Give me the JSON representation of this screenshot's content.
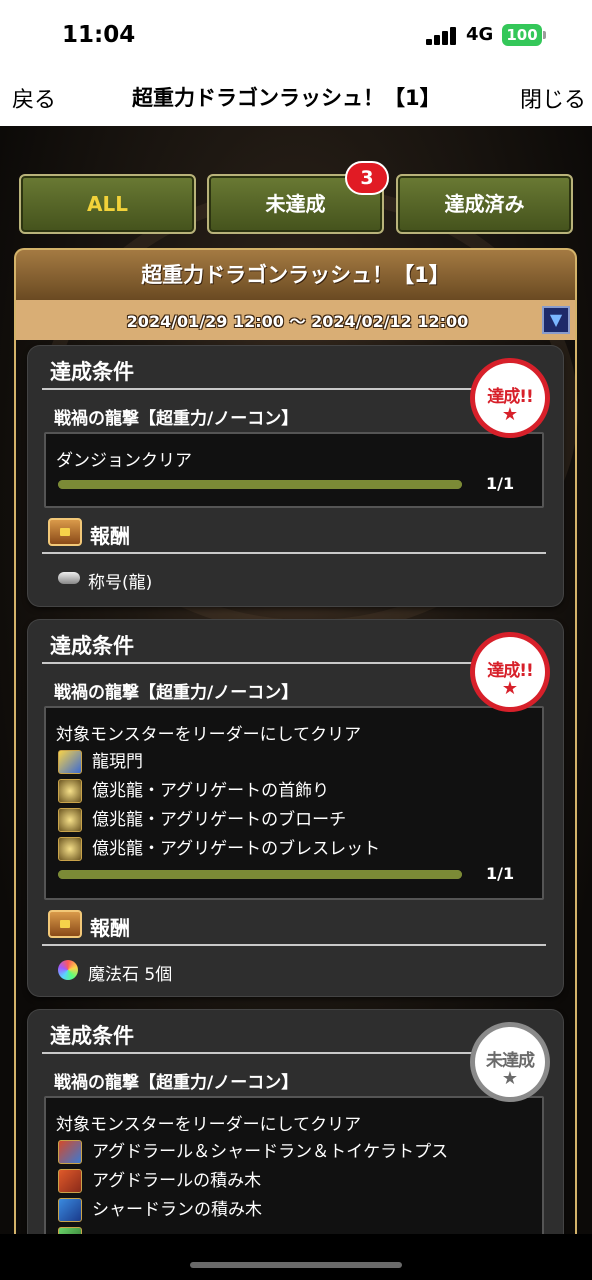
{
  "status_bar": {
    "time": "11:04",
    "network": "4G",
    "battery": "100"
  },
  "nav": {
    "back_label": "戻る",
    "title": "超重力ドラゴンラッシュ！【1】",
    "close_label": "閉じる"
  },
  "tabs": [
    {
      "label": "ALL",
      "active": true
    },
    {
      "label": "未達成",
      "badge": "3"
    },
    {
      "label": "達成済み"
    }
  ],
  "event": {
    "title": "超重力ドラゴンラッシュ！【1】",
    "period": "2024/01/29 12:00 〜 2024/02/12 12:00",
    "dropdown_icon": "▼"
  },
  "missions": [
    {
      "heading": "達成条件",
      "subtitle": "戦禍の龍撃【超重力/ノーコン】",
      "condition": "ダンジョンクリア",
      "monsters": [],
      "progress": "1/1",
      "progress_fraction": 1.0,
      "reward_heading": "報酬",
      "reward": "称号(龍)",
      "stamp": "達成!!",
      "stamp_star": "★"
    },
    {
      "heading": "達成条件",
      "subtitle": "戦禍の龍撃【超重力/ノーコン】",
      "condition": "対象モンスターをリーダーにしてクリア",
      "monsters": [
        "龍現門",
        "億兆龍・アグリゲートの首飾り",
        "億兆龍・アグリゲートのブローチ",
        "億兆龍・アグリゲートのブレスレット"
      ],
      "progress": "1/1",
      "progress_fraction": 1.0,
      "reward_heading": "報酬",
      "reward": "魔法石 5個",
      "stamp": "達成!!",
      "stamp_star": "★"
    },
    {
      "heading": "達成条件",
      "subtitle": "戦禍の龍撃【超重力/ノーコン】",
      "condition": "対象モンスターをリーダーにしてクリア",
      "monsters": [
        "アグドラール＆シャードラン＆トイケラトプス",
        "アグドラールの積み木",
        "シャードランの積み木"
      ],
      "stamp": "未達成",
      "stamp_star": "★"
    }
  ],
  "colors": {
    "accent_tab": "#f2d23a",
    "badge": "#e11b24",
    "progress": "#7b8a36",
    "stamp_done": "#d7202a",
    "stamp_pending": "#8a8a8a"
  }
}
